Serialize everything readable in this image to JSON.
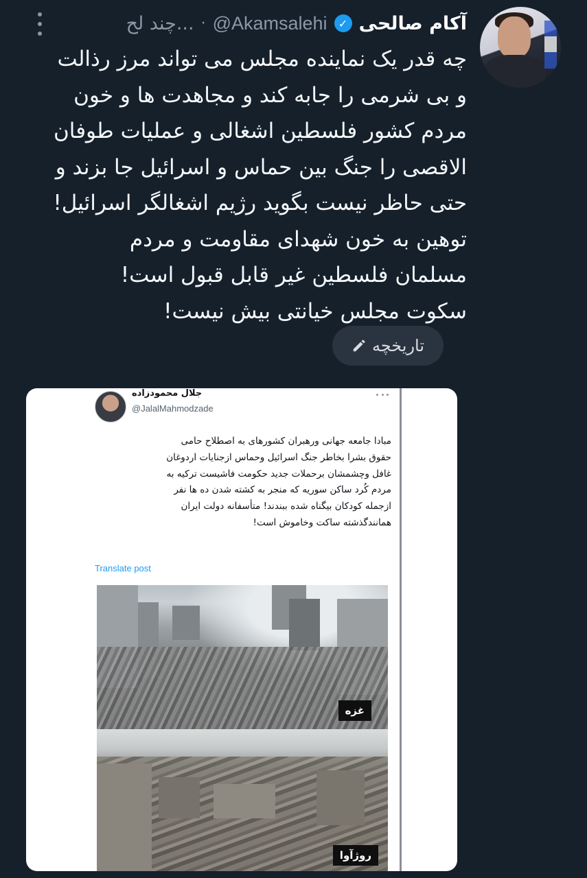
{
  "tweet": {
    "display_name": "آکام صالحی",
    "handle": "@Akamsalehi",
    "separator": "·",
    "time": "چند لح...",
    "text_lines": [
      "چه قدر یک نماینده مجلس می تواند مرز رذالت",
      "و بی شرمی را جابه کند و مجاهدت ها و خون",
      "مردم کشور فلسطین اشغالی و عملیات طوفان",
      "الاقصی را جنگ بین حماس و اسرائیل جا بزند و",
      "حتی حاظر نیست بگوید رژیم اشغالگر اسرائیل!",
      "توهین به خون شهدای مقاومت و مردم",
      "مسلمان فلسطین غیر قابل قبول است!",
      "سکوت مجلس خیانتی بیش نیست!"
    ],
    "history_label": "تاریخچه",
    "verified_glyph": "✓"
  },
  "quoted": {
    "name": "جلال محمودزاده",
    "handle": "@JalalMahmodzade",
    "text_lines": [
      "مبادا جامعه جهانی ورهبران کشورهای به اصطلاح حامی",
      "حقوق بشرا بخاطر جنگ اسرائیل وحماس ازجنایات اردوغان",
      "غافل وچشمشان برحملات جدید حکومت فاشیست ترکیه به",
      "مردم کُرد ساکن سوریه که منجر به کشته شدن ده ها نفر",
      "ازجمله کودکان بیگناه شده ببندند! متأسفانه دولت ایران",
      "همانندگذشته ساکت وخاموش است!"
    ],
    "translate_label": "Translate post",
    "photo_labels": [
      "غزه",
      "روژآوا"
    ]
  },
  "icons": [
    "verified-badge-icon",
    "more-options-icon",
    "pencil-icon"
  ],
  "colors": {
    "background": "#15202b",
    "text": "#f5f8fa",
    "secondary": "#8b98a5",
    "verified": "#1d9bf0",
    "link": "#1d9bf0",
    "pill": "#2a3441"
  }
}
